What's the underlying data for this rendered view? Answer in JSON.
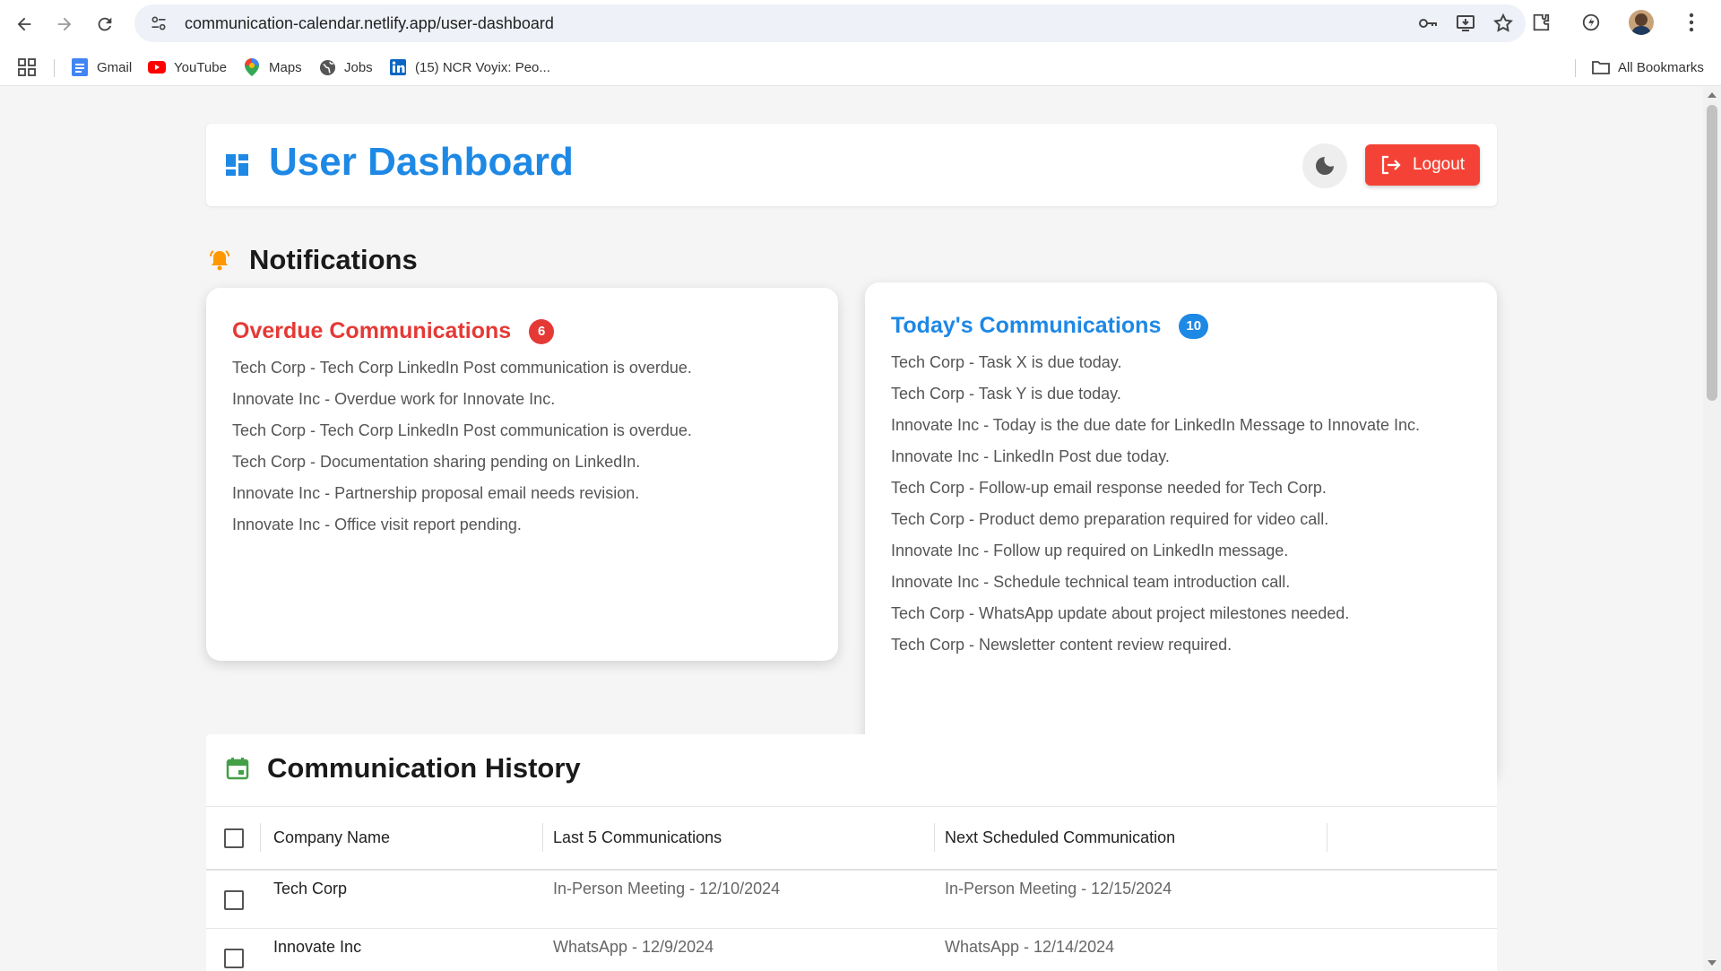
{
  "browser": {
    "url": "communication-calendar.netlify.app/user-dashboard",
    "bookmarks": [
      {
        "label": "Gmail",
        "icon": "gmail-icon"
      },
      {
        "label": "YouTube",
        "icon": "youtube-icon"
      },
      {
        "label": "Maps",
        "icon": "maps-icon"
      },
      {
        "label": "Jobs",
        "icon": "globe-icon"
      },
      {
        "label": "(15) NCR Voyix: Peo...",
        "icon": "linkedin-icon"
      }
    ],
    "all_bookmarks_label": "All Bookmarks"
  },
  "header": {
    "title": "User Dashboard",
    "logout_label": "Logout",
    "accent_color": "#1e88e5",
    "logout_color": "#f44336"
  },
  "notifications": {
    "title": "Notifications",
    "overdue": {
      "title": "Overdue Communications",
      "count": "6",
      "color": "#e53935",
      "items": [
        {
          "company": "Tech Corp",
          "text": " - Tech Corp LinkedIn Post communication is overdue."
        },
        {
          "company": "Innovate Inc",
          "text": " - Overdue work for Innovate Inc."
        },
        {
          "company": "Tech Corp",
          "text": " - Tech Corp LinkedIn Post communication is overdue."
        },
        {
          "company": "Tech Corp",
          "text": " - Documentation sharing pending on LinkedIn."
        },
        {
          "company": "Innovate Inc",
          "text": " - Partnership proposal email needs revision."
        },
        {
          "company": "Innovate Inc",
          "text": " - Office visit report pending."
        }
      ]
    },
    "today": {
      "title": "Today's Communications",
      "count": "10",
      "color": "#1e88e5",
      "items": [
        {
          "company": "Tech Corp",
          "text": " - Task X is due today."
        },
        {
          "company": "Tech Corp",
          "text": " - Task Y is due today."
        },
        {
          "company": "Innovate Inc",
          "text": " - Today is the due date for LinkedIn Message to Innovate Inc."
        },
        {
          "company": "Innovate Inc",
          "text": " - LinkedIn Post due today."
        },
        {
          "company": "Tech Corp",
          "text": " - Follow-up email response needed for Tech Corp."
        },
        {
          "company": "Tech Corp",
          "text": " - Product demo preparation required for video call."
        },
        {
          "company": "Innovate Inc",
          "text": " - Follow up required on LinkedIn message."
        },
        {
          "company": "Innovate Inc",
          "text": " - Schedule technical team introduction call."
        },
        {
          "company": "Tech Corp",
          "text": " - WhatsApp update about project milestones needed."
        },
        {
          "company": "Tech Corp",
          "text": " - Newsletter content review required."
        }
      ]
    }
  },
  "history": {
    "title": "Communication History",
    "columns": [
      "Company Name",
      "Last 5 Communications",
      "Next Scheduled Communication"
    ],
    "rows": [
      {
        "company": "Tech Corp",
        "last": "In-Person Meeting - 12/10/2024",
        "next": "In-Person Meeting - 12/15/2024"
      },
      {
        "company": "Innovate Inc",
        "last": "WhatsApp - 12/9/2024",
        "next": "WhatsApp - 12/14/2024"
      }
    ]
  }
}
